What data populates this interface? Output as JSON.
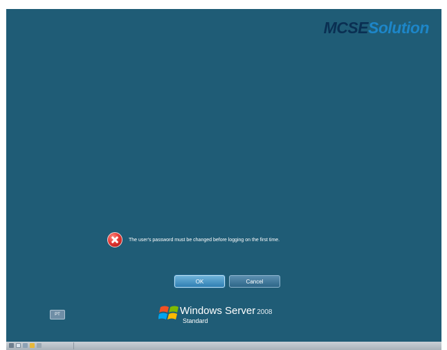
{
  "watermark": {
    "part1": "MCSE",
    "part2": "Solution"
  },
  "message": {
    "icon": "error-icon",
    "text": "The user's password must be changed before logging on the first time."
  },
  "buttons": {
    "ok_label": "OK",
    "cancel_label": "Cancel"
  },
  "language": {
    "code": "PT"
  },
  "branding": {
    "product": "Windows Server",
    "version": "2008",
    "edition": "Standard"
  },
  "taskbar": {
    "icons": [
      "network-icon",
      "computer-icon",
      "window-icon",
      "folder-icon",
      "sound-icon"
    ]
  },
  "colors": {
    "background": "#1f5c76",
    "error_red": "#e53935",
    "ok_button": "#2f7fb3",
    "watermark_dark": "#0a2f52",
    "watermark_light": "#1d86c8"
  }
}
